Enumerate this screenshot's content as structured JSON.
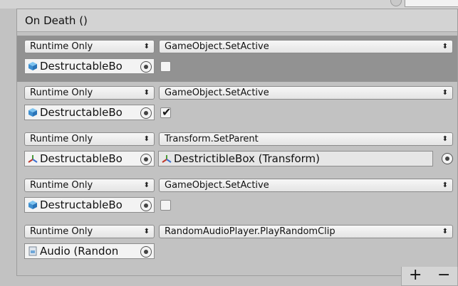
{
  "header": {
    "title": "On Death ()"
  },
  "entries": [
    {
      "mode": "Runtime Only",
      "function": "GameObject.SetActive",
      "target": "DestructableBo",
      "target_icon": "gameobject-cube-icon",
      "checked": false,
      "selected": true
    },
    {
      "mode": "Runtime Only",
      "function": "GameObject.SetActive",
      "target": "DestructableBo",
      "target_icon": "gameobject-cube-icon",
      "checked": true,
      "selected": false
    },
    {
      "mode": "Runtime Only",
      "function": "Transform.SetParent",
      "target": "DestructableBo",
      "target_icon": "transform-icon",
      "param": "DestrictibleBox (Transform)",
      "param_icon": "transform-icon",
      "selected": false
    },
    {
      "mode": "Runtime Only",
      "function": "GameObject.SetActive",
      "target": "DestructableBo",
      "target_icon": "gameobject-cube-icon",
      "checked": false,
      "selected": false
    },
    {
      "mode": "Runtime Only",
      "function": "RandomAudioPlayer.PlayRandomClip",
      "target": "Audio (Randon",
      "target_icon": "script-file-icon",
      "selected": false
    }
  ],
  "footer": {
    "add_label": "+",
    "remove_label": "−"
  },
  "colors": {
    "selected_row": "#929292",
    "panel_bg": "#c2c2c2",
    "header_bg": "#d3d3d3"
  }
}
